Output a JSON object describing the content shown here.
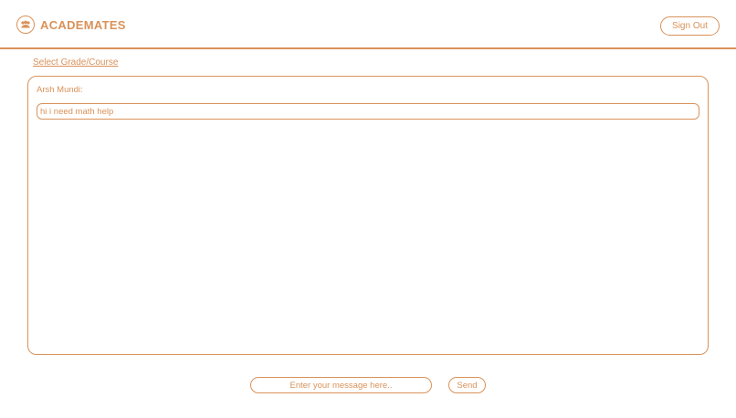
{
  "colors": {
    "accent": "#d9925a",
    "background": "#ffffff"
  },
  "header": {
    "brand_name": "ACADEMATES",
    "logo_icon": "people-icon",
    "sign_out_label": "Sign Out"
  },
  "nav": {
    "select_link": "Select Grade/Course"
  },
  "chat": {
    "messages": [
      {
        "sender": "Arsh Mundi:",
        "text": "hi i need math help"
      }
    ]
  },
  "composer": {
    "placeholder": "Enter your message here..",
    "value": "",
    "send_label": "Send"
  }
}
